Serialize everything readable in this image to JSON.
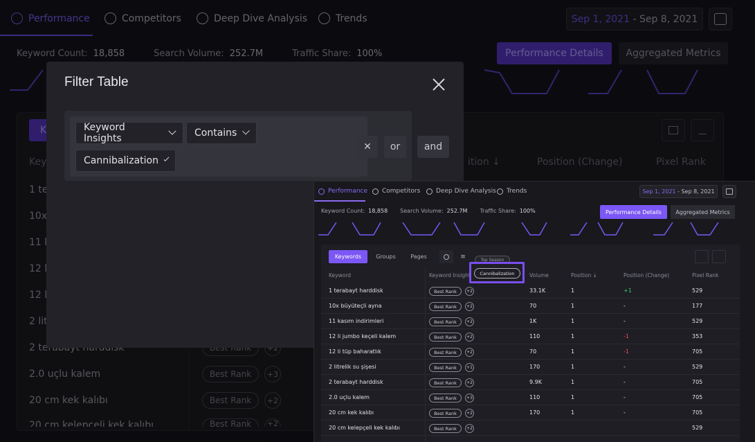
{
  "nav": {
    "tabs": [
      {
        "label": "Performance",
        "icon": "gauge-icon"
      },
      {
        "label": "Competitors",
        "icon": "pie-chart-icon"
      },
      {
        "label": "Deep Dive Analysis",
        "icon": "search-chart-icon"
      },
      {
        "label": "Trends",
        "icon": "trend-icon"
      }
    ],
    "date_start": "Sep 1, 2021",
    "date_sep": " - ",
    "date_end": "Sep 8, 2021"
  },
  "metrics": {
    "keyword_count_label": "Keyword Count:",
    "keyword_count": "18,858",
    "search_volume_label": "Search Volume:",
    "search_volume": "252.7M",
    "traffic_share_label": "Traffic Share:",
    "traffic_share": "100%"
  },
  "actions": {
    "performance_details": "Performance Details",
    "aggregated_metrics": "Aggregated Metrics"
  },
  "background_table": {
    "keywords_btn": "K",
    "columns": {
      "keyword": "Keyw",
      "position": "ition",
      "position_change": "Position (Change)",
      "pixel_rank": "Pixel Rank"
    },
    "rows": [
      {
        "keyword": "1 ter"
      },
      {
        "keyword": "10x b"
      },
      {
        "keyword": "11 ka"
      },
      {
        "keyword": "12 li"
      },
      {
        "keyword": "12 li"
      },
      {
        "keyword": "2 litr"
      },
      {
        "keyword": "2 terabayt harddisk",
        "pill": "Best Rank",
        "plus": "+2"
      },
      {
        "keyword": "2.0 uçlu kalem",
        "pill": "Best Rank",
        "plus": "+3"
      },
      {
        "keyword": "20 cm kek kalıbı",
        "pill": "Best Rank",
        "plus": "+2"
      },
      {
        "keyword": "20 cm kelepçeli kek kalıbı",
        "pill": "Best Rank",
        "plus": "+2"
      }
    ]
  },
  "modal": {
    "title": "Filter Table",
    "field_select": "Keyword Insights",
    "operator_select": "Contains",
    "value_select": "Cannibalization",
    "remove_label": "✕",
    "or_label": "or",
    "and_label": "and"
  },
  "inset": {
    "tabs": [
      "Performance",
      "Competitors",
      "Deep Dive Analysis",
      "Trends"
    ],
    "date_start": "Sep 1, 2021",
    "date_end": " - Sep 8, 2021",
    "metrics": {
      "keyword_count_label": "Keyword Count:",
      "keyword_count": "18,858",
      "search_volume_label": "Search Volume:",
      "search_volume": "252.7M",
      "traffic_share_label": "Traffic Share:",
      "traffic_share": "100%"
    },
    "btn_performance": "Performance Details",
    "btn_aggregated": "Aggregated Metrics",
    "segments": [
      "Keywords",
      "Groups",
      "Pages"
    ],
    "tooltip_pill": "Top Season",
    "highlight_pill": "Cannibalization",
    "columns": [
      "Keyword",
      "Keyword Insight",
      "Volume",
      "Position ↓",
      "Position (Change)",
      "Pixel Rank"
    ],
    "rows": [
      {
        "keyword": "1 terabayt harddisk",
        "pill": "Best Rank",
        "plus": "+2",
        "volume": "33.1K",
        "position": "1",
        "change": "+1",
        "pixel": "529"
      },
      {
        "keyword": "10x büyüteçli ayna",
        "pill": "Best Rank",
        "plus": "+2",
        "volume": "70",
        "position": "1",
        "change": "-",
        "pixel": "177"
      },
      {
        "keyword": "11 kasım indirimleri",
        "pill": "Best Rank",
        "plus": "+2",
        "volume": "1K",
        "position": "1",
        "change": "-",
        "pixel": "529"
      },
      {
        "keyword": "12 li jumbo keçeli kalem",
        "pill": "Best Rank",
        "plus": "+2",
        "volume": "110",
        "position": "1",
        "change": "-1",
        "pixel": "353"
      },
      {
        "keyword": "12 li tüp baharatlık",
        "pill": "Best Rank",
        "plus": "+2",
        "volume": "70",
        "position": "1",
        "change": "-1",
        "pixel": "705"
      },
      {
        "keyword": "2 litrelik su şişesi",
        "pill": "Best Rank",
        "plus": "+1",
        "volume": "170",
        "position": "1",
        "change": "-",
        "pixel": "529"
      },
      {
        "keyword": "2 terabayt harddisk",
        "pill": "Best Rank",
        "plus": "+2",
        "volume": "9.9K",
        "position": "1",
        "change": "-",
        "pixel": "705"
      },
      {
        "keyword": "2.0 uçlu kalem",
        "pill": "Best Rank",
        "plus": "+3",
        "volume": "110",
        "position": "1",
        "change": "-",
        "pixel": "705"
      },
      {
        "keyword": "20 cm kek kalıbı",
        "pill": "Best Rank",
        "plus": "+2",
        "volume": "170",
        "position": "1",
        "change": "-",
        "pixel": "705"
      },
      {
        "keyword": "20 cm kelepçeli kek kalıbı",
        "pill": "Best Rank",
        "plus": "+2",
        "volume": "",
        "position": "",
        "change": "",
        "pixel": "529"
      }
    ]
  },
  "colors": {
    "accent": "#7b57f5",
    "positive": "#3ed06a",
    "negative": "#ff4d5e"
  }
}
